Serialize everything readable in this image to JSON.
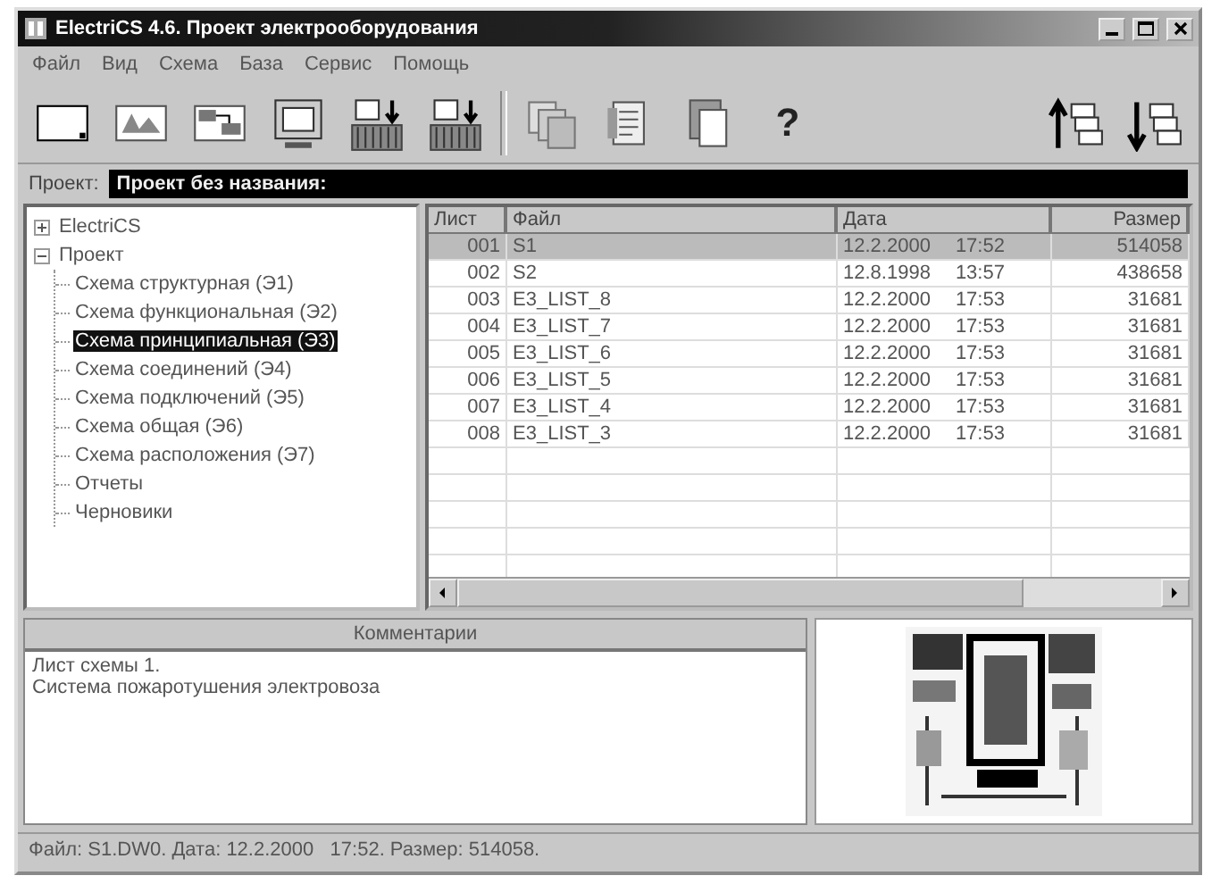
{
  "window": {
    "title": "ElectriCS 4.6. Проект электрооборудования"
  },
  "menu": [
    "Файл",
    "Вид",
    "Схема",
    "База",
    "Сервис",
    "Помощь"
  ],
  "toolbar": [
    {
      "kind": "blank"
    },
    {
      "kind": "image"
    },
    {
      "kind": "layout"
    },
    {
      "kind": "monitor"
    },
    {
      "kind": "export"
    },
    {
      "kind": "export"
    },
    {
      "kind": "stack"
    },
    {
      "kind": "document"
    },
    {
      "kind": "copy"
    },
    {
      "kind": "help",
      "label": "?"
    },
    {
      "kind": "up"
    },
    {
      "kind": "down"
    }
  ],
  "project": {
    "label": "Проект:",
    "value": "Проект без названия:"
  },
  "tree": [
    {
      "label": "ElectriCS",
      "expanded": false,
      "selected": false
    },
    {
      "label": "Проект",
      "expanded": true,
      "selected": false,
      "children": [
        {
          "label": "Схема структурная (Э1)",
          "selected": false
        },
        {
          "label": "Схема функциональная (Э2)",
          "selected": false
        },
        {
          "label": "Схема принципиальная (Э3)",
          "selected": true
        },
        {
          "label": "Схема соединений (Э4)",
          "selected": false
        },
        {
          "label": "Схема подключений (Э5)",
          "selected": false
        },
        {
          "label": "Схема общая (Э6)",
          "selected": false
        },
        {
          "label": "Схема расположения (Э7)",
          "selected": false
        },
        {
          "label": "Отчеты",
          "selected": false
        },
        {
          "label": "Черновики",
          "selected": false
        }
      ]
    }
  ],
  "table": {
    "columns": [
      "Лист",
      "Файл",
      "Дата",
      "Размер"
    ],
    "rows": [
      {
        "sheet": "001",
        "file": "S1",
        "date": "12.2.2000",
        "time": "17:52",
        "size": "514058",
        "selected": true
      },
      {
        "sheet": "002",
        "file": "S2",
        "date": "12.8.1998",
        "time": "13:57",
        "size": "438658",
        "selected": false
      },
      {
        "sheet": "003",
        "file": "E3_LIST_8",
        "date": "12.2.2000",
        "time": "17:53",
        "size": "31681",
        "selected": false
      },
      {
        "sheet": "004",
        "file": "E3_LIST_7",
        "date": "12.2.2000",
        "time": "17:53",
        "size": "31681",
        "selected": false
      },
      {
        "sheet": "005",
        "file": "E3_LIST_6",
        "date": "12.2.2000",
        "time": "17:53",
        "size": "31681",
        "selected": false
      },
      {
        "sheet": "006",
        "file": "E3_LIST_5",
        "date": "12.2.2000",
        "time": "17:53",
        "size": "31681",
        "selected": false
      },
      {
        "sheet": "007",
        "file": "E3_LIST_4",
        "date": "12.2.2000",
        "time": "17:53",
        "size": "31681",
        "selected": false
      },
      {
        "sheet": "008",
        "file": "E3_LIST_3",
        "date": "12.2.2000",
        "time": "17:53",
        "size": "31681",
        "selected": false
      }
    ]
  },
  "comments": {
    "title": "Комментарии",
    "lines": [
      "Лист схемы 1.",
      "Система пожаротушения электровоза"
    ]
  },
  "status_bar": "Файл: S1.DW0. Дата: 12.2.2000   17:52. Размер: 514058."
}
